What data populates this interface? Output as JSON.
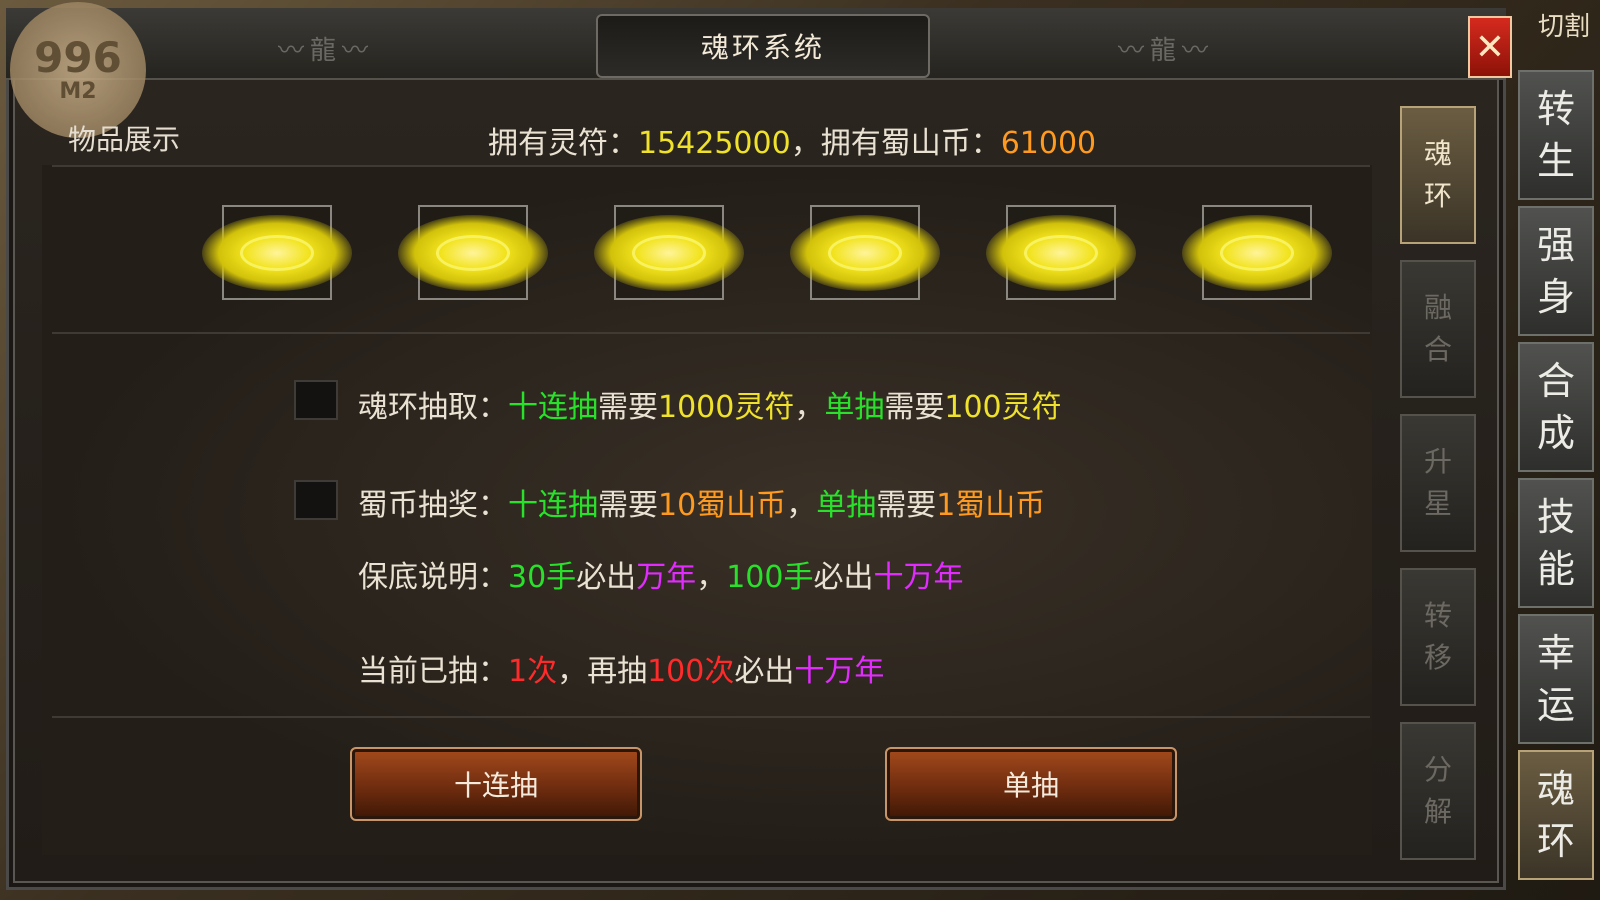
{
  "window": {
    "title": "魂环系统",
    "close_icon": "close-icon",
    "cut_label": "切割"
  },
  "logo": {
    "number": "996",
    "sub": "M2"
  },
  "display_section": {
    "label": "物品展示"
  },
  "currency": {
    "lingfu_label": "拥有灵符：",
    "lingfu_value": "15425000",
    "sep": "，",
    "shushan_label": "拥有蜀山币：",
    "shushan_value": "61000"
  },
  "soul_rings": {
    "count": 6,
    "color": "#f0e22a"
  },
  "draw_rule": {
    "label": "魂环抽取：",
    "ten_label": "十连抽",
    "need1": "需要",
    "ten_cost": "1000灵符",
    "sep": "，",
    "single_label": "单抽",
    "need2": "需要",
    "single_cost": "100灵符"
  },
  "coin_rule": {
    "label": "蜀币抽奖：",
    "ten_label": "十连抽",
    "need1": "需要",
    "ten_cost": "10蜀山币",
    "sep": "，",
    "single_label": "单抽",
    "need2": "需要",
    "single_cost": "1蜀山币"
  },
  "guarantee": {
    "label": "保底说明：",
    "a_count": "30手",
    "a_text": "必出",
    "a_item": "万年",
    "sep": "，",
    "b_count": "100手",
    "b_text": "必出",
    "b_item": "十万年"
  },
  "progress": {
    "label": "当前已抽：",
    "drawn": "1次",
    "sep": "，再抽",
    "remaining": "100次",
    "text": "必出",
    "item": "十万年"
  },
  "buttons": {
    "ten_draw": "十连抽",
    "single_draw": "单抽"
  },
  "right_tabs": [
    {
      "label": "魂\n环",
      "active": true
    },
    {
      "label": "融\n合",
      "active": false
    },
    {
      "label": "升\n星",
      "active": false
    },
    {
      "label": "转\n移",
      "active": false
    },
    {
      "label": "分\n解",
      "active": false
    }
  ],
  "side_nav": [
    {
      "label": "转\n生",
      "active": false
    },
    {
      "label": "强\n身",
      "active": false
    },
    {
      "label": "合\n成",
      "active": false
    },
    {
      "label": "技\n能",
      "active": false
    },
    {
      "label": "幸\n运",
      "active": false
    },
    {
      "label": "魂\n环",
      "active": true
    }
  ]
}
